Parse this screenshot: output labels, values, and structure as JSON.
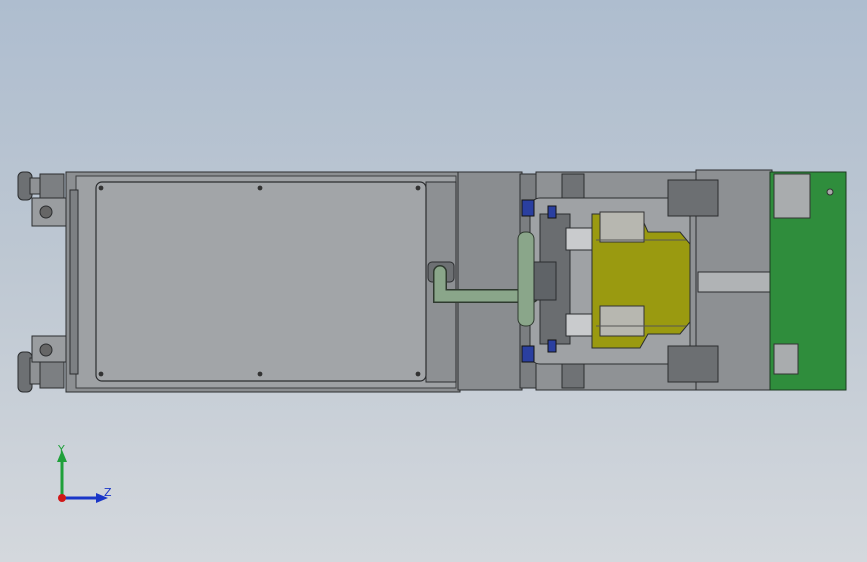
{
  "viewport": {
    "background_top": "#aebdcf",
    "background_bottom": "#d4d8dd"
  },
  "model": {
    "colors": {
      "frame": "#8c8f92",
      "plate": "#a2a5a8",
      "dark_steel": "#5f6367",
      "olive_plate": "#9a9a10",
      "green_board": "#2f8d3c",
      "pipe": "#8aa68a",
      "blue_part": "#2a3fa0"
    },
    "icons": [
      "wheel-icon",
      "bolt-icon",
      "pipe-handle-icon"
    ]
  },
  "triad": {
    "y_label": "Y",
    "z_label": "Z",
    "y_color": "#1fa03a",
    "z_color": "#1a36c8",
    "origin_color": "#d01818"
  }
}
